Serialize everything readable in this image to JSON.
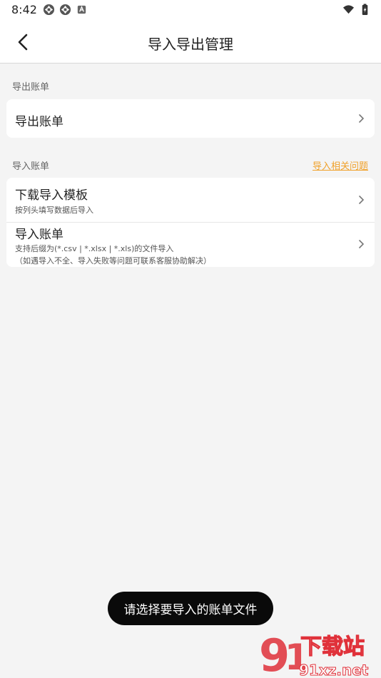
{
  "status_bar": {
    "time": "8:42"
  },
  "app_bar": {
    "title": "导入导出管理"
  },
  "export_section": {
    "label": "导出账单",
    "rows": [
      {
        "title": "导出账单"
      }
    ]
  },
  "import_section": {
    "label": "导入账单",
    "help_link": "导入相关问题",
    "rows": [
      {
        "title": "下载导入模板",
        "subtitle": "按列头填写数据后导入"
      },
      {
        "title": "导入账单",
        "subtitle_1": "支持后缀为(*.csv | *.xlsx | *.xls)的文件导入",
        "subtitle_2": "（如遇导入不全、导入失败等问题可联系客服协助解决）"
      }
    ]
  },
  "toast": {
    "text": "请选择要导入的账单文件"
  },
  "watermark": {
    "brand": "下载站",
    "domain": "91xz.net"
  },
  "colors": {
    "accent": "#f0a12a",
    "background": "#f4f4f4",
    "card": "#ffffff",
    "toast_bg": "#0a0a0a"
  }
}
